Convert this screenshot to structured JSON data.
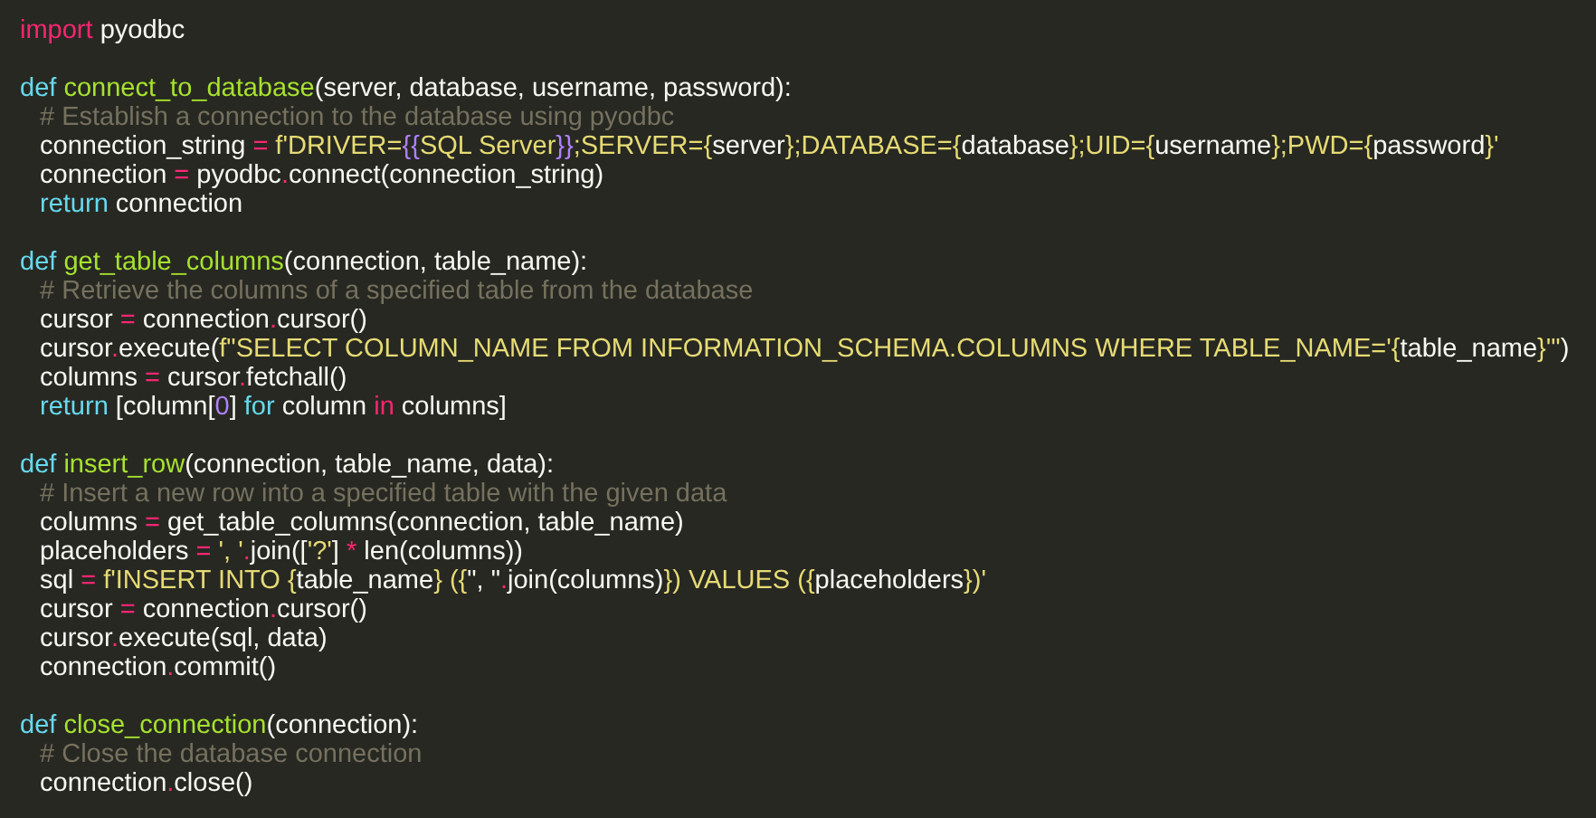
{
  "editor": {
    "blocks": [
      {
        "header": [
          {
            "kind": "keyword",
            "text": "import"
          },
          {
            "kind": "plain",
            "text": " pyodbc"
          }
        ]
      },
      {
        "header": [
          {
            "kind": "storage",
            "text": "def"
          },
          {
            "kind": "function",
            "text": " connect_to_database"
          },
          {
            "kind": "plain",
            "text": "(server, database, username, password):"
          }
        ],
        "body": [
          [
            {
              "kind": "comment",
              "text": "# Establish a connection to the database using pyodbc"
            }
          ],
          [
            {
              "kind": "plain",
              "text": "connection_string "
            },
            {
              "kind": "keyword",
              "text": "="
            },
            {
              "kind": "string",
              "text": " f'DRIVER="
            },
            {
              "kind": "constant",
              "text": "{{"
            },
            {
              "kind": "string",
              "text": "SQL Server"
            },
            {
              "kind": "constant",
              "text": "}}"
            },
            {
              "kind": "string",
              "text": ";SERVER={"
            },
            {
              "kind": "plain",
              "text": "server"
            },
            {
              "kind": "string",
              "text": "};DATABASE={"
            },
            {
              "kind": "plain",
              "text": "database"
            },
            {
              "kind": "string",
              "text": "};UID={"
            },
            {
              "kind": "plain",
              "text": "username"
            },
            {
              "kind": "string",
              "text": "};PWD={"
            },
            {
              "kind": "plain",
              "text": "password"
            },
            {
              "kind": "string",
              "text": "}'"
            }
          ],
          [
            {
              "kind": "plain",
              "text": "connection "
            },
            {
              "kind": "keyword",
              "text": "="
            },
            {
              "kind": "plain",
              "text": " pyodbc"
            },
            {
              "kind": "keyword",
              "text": "."
            },
            {
              "kind": "plain",
              "text": "connect(connection_string)"
            }
          ],
          [
            {
              "kind": "storage",
              "text": "return"
            },
            {
              "kind": "plain",
              "text": " connection"
            }
          ]
        ]
      },
      {
        "header": [
          {
            "kind": "storage",
            "text": "def"
          },
          {
            "kind": "function",
            "text": " get_table_columns"
          },
          {
            "kind": "plain",
            "text": "(connection, table_name):"
          }
        ],
        "body": [
          [
            {
              "kind": "comment",
              "text": "# Retrieve the columns of a specified table from the database"
            }
          ],
          [
            {
              "kind": "plain",
              "text": "cursor "
            },
            {
              "kind": "keyword",
              "text": "="
            },
            {
              "kind": "plain",
              "text": " connection"
            },
            {
              "kind": "keyword",
              "text": "."
            },
            {
              "kind": "plain",
              "text": "cursor()"
            }
          ],
          [
            {
              "kind": "plain",
              "text": "cursor"
            },
            {
              "kind": "keyword",
              "text": "."
            },
            {
              "kind": "plain",
              "text": "execute("
            },
            {
              "kind": "string",
              "text": "f\"SELECT COLUMN_NAME FROM INFORMATION_SCHEMA.COLUMNS WHERE TABLE_NAME='{"
            },
            {
              "kind": "plain",
              "text": "table_name"
            },
            {
              "kind": "string",
              "text": "}'\""
            },
            {
              "kind": "plain",
              "text": ")"
            }
          ],
          [
            {
              "kind": "plain",
              "text": "columns "
            },
            {
              "kind": "keyword",
              "text": "="
            },
            {
              "kind": "plain",
              "text": " cursor"
            },
            {
              "kind": "keyword",
              "text": "."
            },
            {
              "kind": "plain",
              "text": "fetchall()"
            }
          ],
          [
            {
              "kind": "storage",
              "text": "return"
            },
            {
              "kind": "plain",
              "text": " [column["
            },
            {
              "kind": "constant",
              "text": "0"
            },
            {
              "kind": "plain",
              "text": "] "
            },
            {
              "kind": "storage",
              "text": "for"
            },
            {
              "kind": "plain",
              "text": " column "
            },
            {
              "kind": "keyword",
              "text": "in"
            },
            {
              "kind": "plain",
              "text": " columns]"
            }
          ]
        ]
      },
      {
        "header": [
          {
            "kind": "storage",
            "text": "def"
          },
          {
            "kind": "function",
            "text": " insert_row"
          },
          {
            "kind": "plain",
            "text": "(connection, table_name, data):"
          }
        ],
        "body": [
          [
            {
              "kind": "comment",
              "text": "# Insert a new row into a specified table with the given data"
            }
          ],
          [
            {
              "kind": "plain",
              "text": "columns "
            },
            {
              "kind": "keyword",
              "text": "="
            },
            {
              "kind": "plain",
              "text": " get_table_columns(connection, table_name)"
            }
          ],
          [
            {
              "kind": "plain",
              "text": "placeholders "
            },
            {
              "kind": "keyword",
              "text": "="
            },
            {
              "kind": "string",
              "text": " ', '"
            },
            {
              "kind": "keyword",
              "text": "."
            },
            {
              "kind": "plain",
              "text": "join(["
            },
            {
              "kind": "string",
              "text": "'?'"
            },
            {
              "kind": "plain",
              "text": "] "
            },
            {
              "kind": "keyword",
              "text": "*"
            },
            {
              "kind": "plain",
              "text": " len(columns))"
            }
          ],
          [
            {
              "kind": "plain",
              "text": "sql "
            },
            {
              "kind": "keyword",
              "text": "="
            },
            {
              "kind": "string",
              "text": " f'INSERT INTO {"
            },
            {
              "kind": "plain",
              "text": "table_name"
            },
            {
              "kind": "string",
              "text": "} ({"
            },
            {
              "kind": "plain",
              "text": "\", \""
            },
            {
              "kind": "keyword",
              "text": "."
            },
            {
              "kind": "plain",
              "text": "join(columns)"
            },
            {
              "kind": "string",
              "text": "}) VALUES ({"
            },
            {
              "kind": "plain",
              "text": "placeholders"
            },
            {
              "kind": "string",
              "text": "})'"
            }
          ],
          [
            {
              "kind": "plain",
              "text": "cursor "
            },
            {
              "kind": "keyword",
              "text": "="
            },
            {
              "kind": "plain",
              "text": " connection"
            },
            {
              "kind": "keyword",
              "text": "."
            },
            {
              "kind": "plain",
              "text": "cursor()"
            }
          ],
          [
            {
              "kind": "plain",
              "text": "cursor"
            },
            {
              "kind": "keyword",
              "text": "."
            },
            {
              "kind": "plain",
              "text": "execute(sql, data)"
            }
          ],
          [
            {
              "kind": "plain",
              "text": "connection"
            },
            {
              "kind": "keyword",
              "text": "."
            },
            {
              "kind": "plain",
              "text": "commit()"
            }
          ]
        ]
      },
      {
        "header": [
          {
            "kind": "storage",
            "text": "def"
          },
          {
            "kind": "function",
            "text": " close_connection"
          },
          {
            "kind": "plain",
            "text": "(connection):"
          }
        ],
        "body": [
          [
            {
              "kind": "comment",
              "text": "# Close the database connection"
            }
          ],
          [
            {
              "kind": "plain",
              "text": "connection"
            },
            {
              "kind": "keyword",
              "text": "."
            },
            {
              "kind": "plain",
              "text": "close()"
            }
          ]
        ]
      }
    ]
  }
}
